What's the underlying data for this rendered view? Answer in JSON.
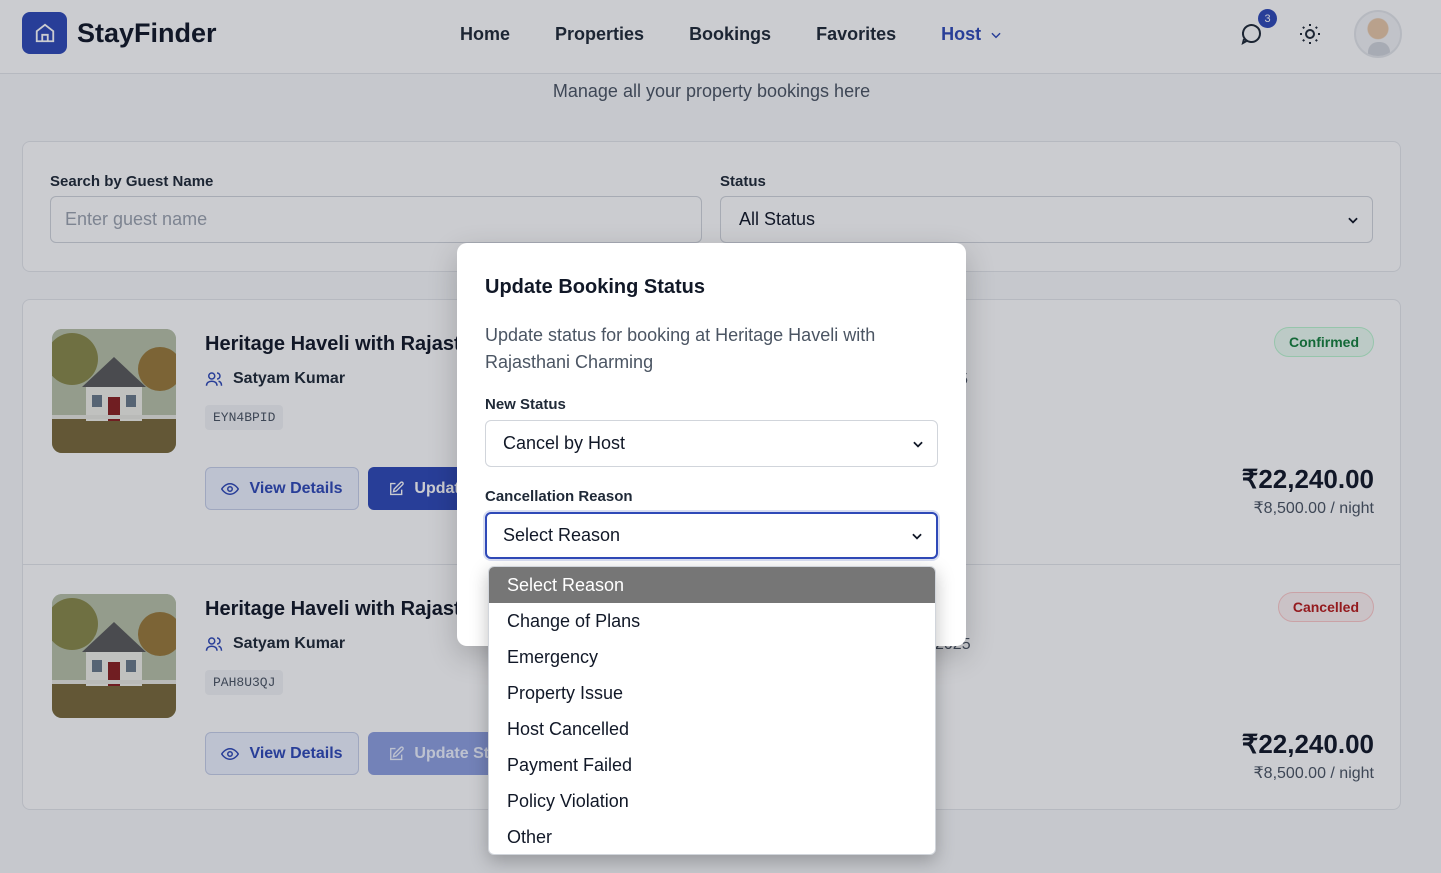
{
  "app": {
    "name": "StayFinder"
  },
  "nav": {
    "items": [
      "Home",
      "Properties",
      "Bookings",
      "Favorites"
    ],
    "host_label": "Host"
  },
  "header": {
    "message_badge": "3"
  },
  "page": {
    "subtitle": "Manage all your property bookings here"
  },
  "filters": {
    "search_label": "Search by Guest Name",
    "search_placeholder": "Enter guest name",
    "status_label": "Status",
    "status_value": "All Status"
  },
  "bookings": [
    {
      "title": "Heritage Haveli with Rajasthani Charming",
      "guest": "Satyam Kumar",
      "code": "EYN4BPID",
      "status": "Confirmed",
      "total": "₹22,240.00",
      "per_night": "₹8,500.00 / night",
      "view_label": "View Details",
      "update_label": "Update Status",
      "date_fragment": "5"
    },
    {
      "title": "Heritage Haveli with Rajasthani Charming",
      "guest": "Satyam Kumar",
      "code": "PAH8U3QJ",
      "status": "Cancelled",
      "total": "₹22,240.00",
      "per_night": "₹8,500.00 / night",
      "view_label": "View Details",
      "update_label": "Update Status",
      "date_fragment": "2025"
    }
  ],
  "modal": {
    "title": "Update Booking Status",
    "description": "Update status for booking at Heritage Haveli with Rajasthani Charming",
    "new_status_label": "New Status",
    "new_status_value": "Cancel by Host",
    "reason_label": "Cancellation Reason",
    "reason_value": "Select Reason"
  },
  "reason_options": [
    "Select Reason",
    "Change of Plans",
    "Emergency",
    "Property Issue",
    "Host Cancelled",
    "Payment Failed",
    "Policy Violation",
    "Other"
  ],
  "colors": {
    "brand": "#2f49b8",
    "confirmed": "#15803d",
    "cancelled": "#b91c1c"
  }
}
